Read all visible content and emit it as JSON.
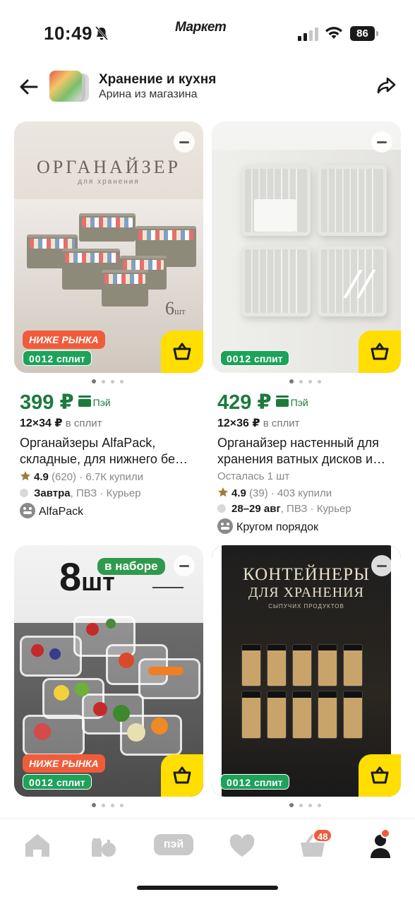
{
  "status_bar": {
    "time": "10:49",
    "brand": "Маркет",
    "battery": "86"
  },
  "header": {
    "title": "Хранение и кухня",
    "subtitle": "Арина из магазина"
  },
  "products": [
    {
      "price": "399 ₽",
      "pay_label": "Пэй",
      "split_amount": "12×34 ₽",
      "split_label": "в сплит",
      "title": "Органайзеры AlfaPack, складные, для нижнего бе…",
      "rating": "4.9",
      "reviews": "(620)",
      "bought": "· 6.7К купили",
      "delivery_date": "Завтра",
      "delivery_rest": ", ПВЗ · Курьер",
      "shop": "AlfaPack",
      "badge_market": "НИЖЕ РЫНКА",
      "badge_split_num": "0012",
      "badge_split_label": "сплит",
      "photo_text": {
        "title": "ОРГАНАЙЗЕР",
        "sub": "для хранения",
        "qty_num": "6",
        "qty_unit": "шт"
      }
    },
    {
      "price": "429 ₽",
      "pay_label": "Пэй",
      "split_amount": "12×36 ₽",
      "split_label": "в сплит",
      "title": "Органайзер настенный для хранения ватных дисков и…",
      "stock": "Осталась 1 шт",
      "rating": "4.9",
      "reviews": "(39)",
      "bought": "· 403 купили",
      "delivery_date": "28–29 авг",
      "delivery_rest": ", ПВЗ · Курьер",
      "shop": "Кругом порядок",
      "badge_split_num": "0012",
      "badge_split_label": "сплит"
    },
    {
      "badge_market": "НИЖЕ РЫНКА",
      "badge_split_num": "0012",
      "badge_split_label": "сплит",
      "photo_text": {
        "big": "8",
        "unit": "шт",
        "tag": "в наборе"
      }
    },
    {
      "badge_split_num": "0012",
      "badge_split_label": "сплит",
      "photo_text": {
        "title": "КОНТЕЙНЕРЫ",
        "sub": "ДЛЯ ХРАНЕНИЯ",
        "small": "СЫПУЧИХ ПРОДУКТОВ"
      }
    }
  ],
  "nav": {
    "pay_label": "пэй",
    "cart_count": "48"
  },
  "colors": {
    "price_green": "#1d7a3e",
    "accent_yellow": "#ffde00",
    "badge_orange": "#f05c3b",
    "split_green": "#1da25a",
    "stock_red": "#d3232f"
  }
}
